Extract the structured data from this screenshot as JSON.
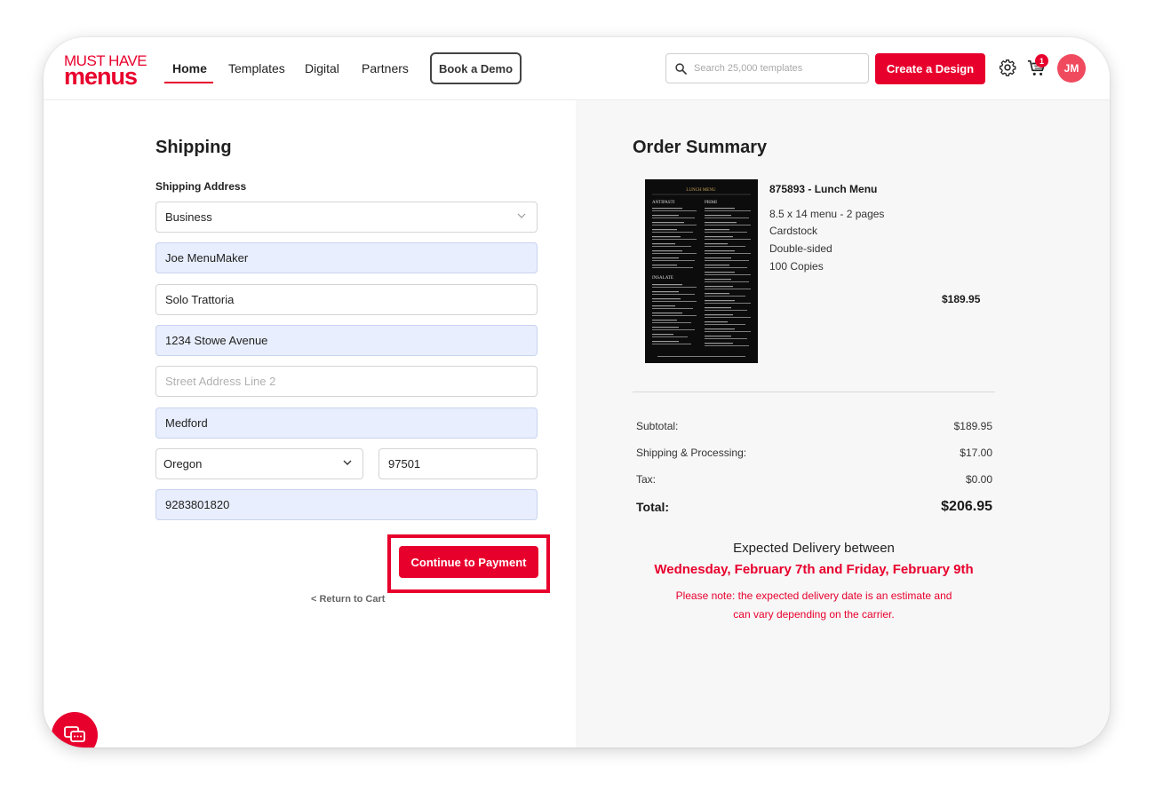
{
  "brand": {
    "line1": "MUST HAVE",
    "line2": "menus"
  },
  "nav": {
    "home": "Home",
    "templates": "Templates",
    "digital": "Digital",
    "partners": "Partners",
    "book_demo": "Book a Demo"
  },
  "search": {
    "placeholder": "Search 25,000 templates"
  },
  "header": {
    "create_label": "Create a Design",
    "cart_count": "1",
    "avatar_initials": "JM"
  },
  "shipping": {
    "title": "Shipping",
    "address_label": "Shipping Address",
    "address_type": "Business",
    "name": "Joe MenuMaker",
    "company": "Solo Trattoria",
    "street1": "1234 Stowe Avenue",
    "street2_placeholder": "Street Address Line 2",
    "city": "Medford",
    "state": "Oregon",
    "zip": "97501",
    "phone": "9283801820",
    "return_link": "< Return to Cart",
    "continue_label": "Continue to Payment"
  },
  "summary": {
    "title": "Order Summary",
    "product": {
      "title": "875893 - Lunch Menu",
      "size": "8.5 x 14 menu - 2 pages",
      "paper": "Cardstock",
      "sides": "Double-sided",
      "copies": "100 Copies",
      "price": "$189.95"
    },
    "thumbnail": {
      "heading": "LUNCH MENU",
      "col1_heading": "ANTIPASTI",
      "col1_heading2": "INSALATE",
      "col2_heading": "PRIMI"
    },
    "subtotal_label": "Subtotal:",
    "subtotal": "$189.95",
    "shipping_label": "Shipping & Processing:",
    "shipping": "$17.00",
    "tax_label": "Tax:",
    "tax": "$0.00",
    "total_label": "Total:",
    "total": "$206.95"
  },
  "delivery": {
    "heading": "Expected Delivery between",
    "dates": "Wednesday, February 7th and Friday, February 9th",
    "note": "Please note: the expected delivery date is an estimate and can vary depending on the carrier."
  },
  "colors": {
    "accent": "#e8002d",
    "autofill": "#e8eefd",
    "summary_bg": "#f7f7f7"
  },
  "icons": [
    "search-icon",
    "gear-icon",
    "cart-icon",
    "chevron-down-icon",
    "chat-icon"
  ]
}
